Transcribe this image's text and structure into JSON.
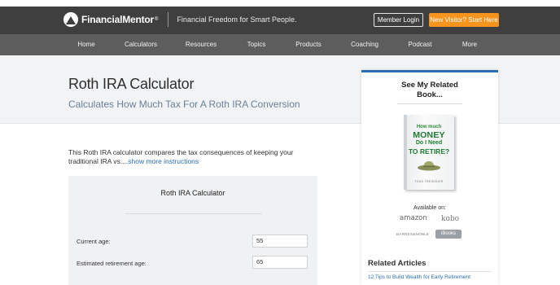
{
  "header": {
    "brand": "FinancialMentor",
    "brand_mark": "®",
    "tagline": "Financial Freedom for Smart People.",
    "login_label": "Member Login",
    "visitor_label": "New Visitor? Start Here",
    "accent_color": "#f7941d"
  },
  "nav": {
    "items": [
      {
        "label": "Home"
      },
      {
        "label": "Calculators"
      },
      {
        "label": "Resources"
      },
      {
        "label": "Topics"
      },
      {
        "label": "Products"
      },
      {
        "label": "Coaching"
      },
      {
        "label": "Podcast"
      },
      {
        "label": "More"
      }
    ]
  },
  "hero": {
    "title": "Roth IRA Calculator",
    "subtitle": "Calculates How Much Tax For A Roth IRA Conversion"
  },
  "intro": {
    "text": "This Roth IRA calculator compares the tax consequences of keeping your traditional IRA vs....",
    "more_link": "show more instructions"
  },
  "calculator": {
    "title": "Roth IRA Calculator",
    "fields": [
      {
        "label": "Current age:",
        "value": "55"
      },
      {
        "label": "Estimated retirement age:",
        "value": "65"
      }
    ]
  },
  "sidebar": {
    "heading_line1": "See My Related",
    "heading_line2": "Book...",
    "book": {
      "line1": "How much",
      "line2": "MONEY",
      "line3": "Do I Need",
      "line4": "TO RETIRE?",
      "author": "TODD TRESIDDER"
    },
    "available_on": "Available on:",
    "stores": {
      "amazon": "amazon",
      "kobo": "kobo",
      "barnes": "BARNES&NOBLE",
      "ibooks": "iBooks"
    },
    "related_title": "Related Articles",
    "related_links": [
      "12 Tips to Build Wealth for Early Retirement"
    ]
  }
}
